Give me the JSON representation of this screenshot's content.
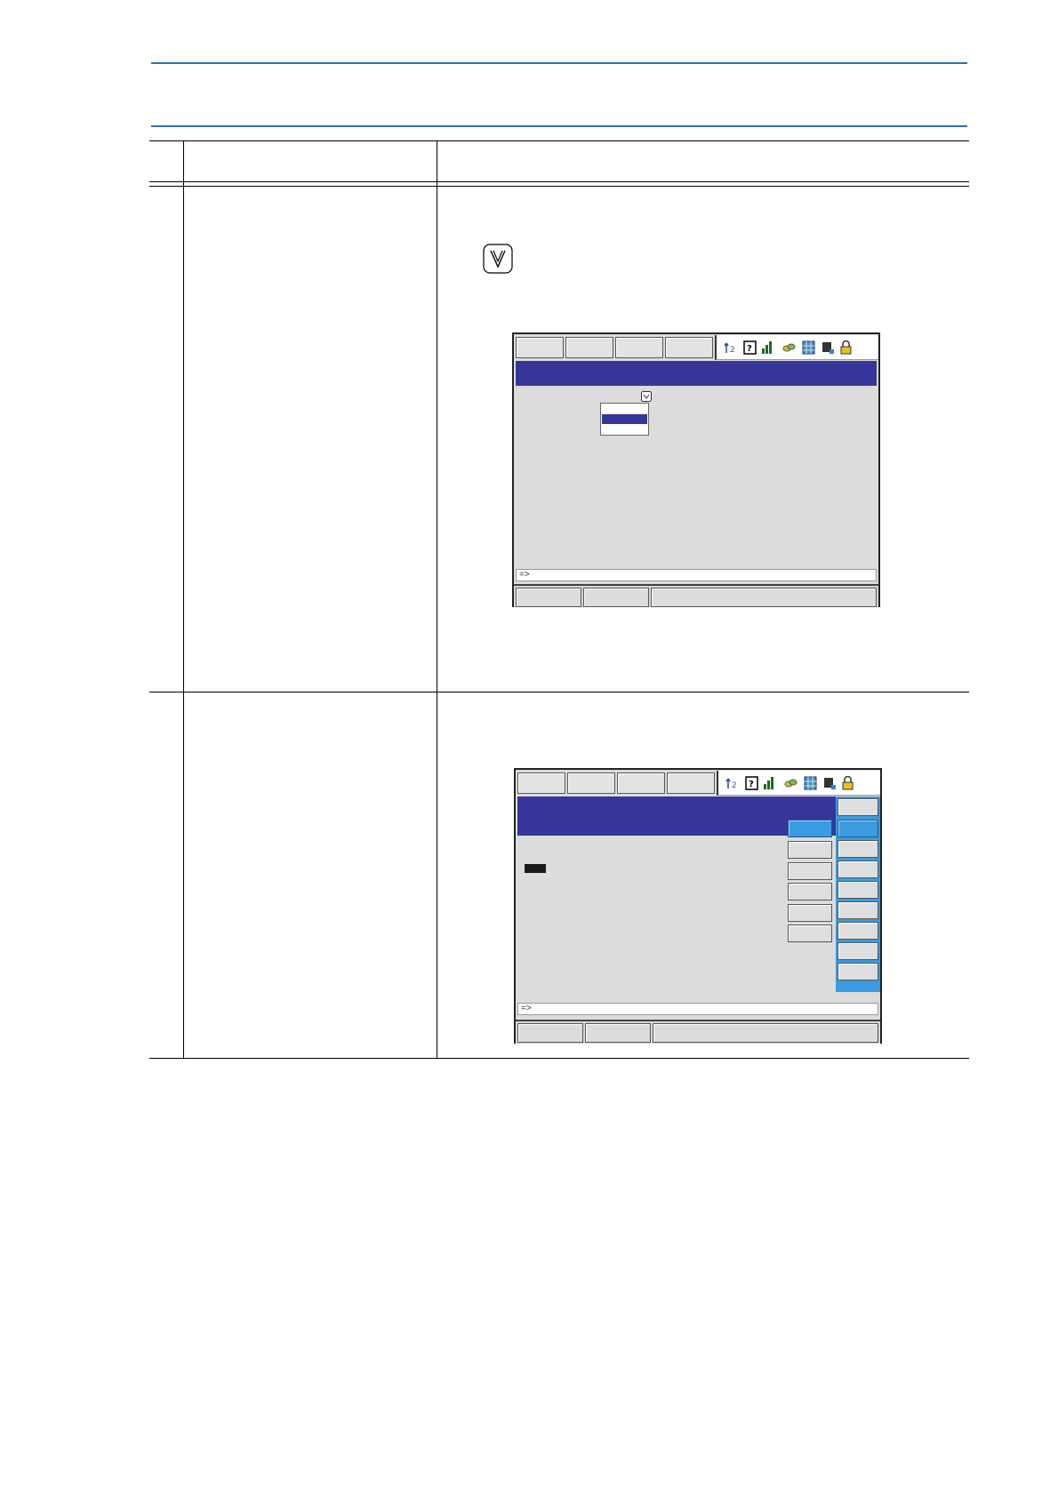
{
  "pendant_screen_1": {
    "input_prompt": "=>"
  },
  "pendant_screen_2": {
    "input_prompt": "=>"
  },
  "colors": {
    "rule": "#2f6fb7",
    "title_bar": "#36369a",
    "selected_menu": "#3a9be0",
    "screen_background": "#dcdcdc"
  },
  "icons": [
    "select-key-icon",
    "arrow-icon",
    "help-icon",
    "signal-icon",
    "link-icon",
    "grid-icon",
    "device-icon",
    "lock-icon",
    "dropdown-arrow-icon"
  ]
}
